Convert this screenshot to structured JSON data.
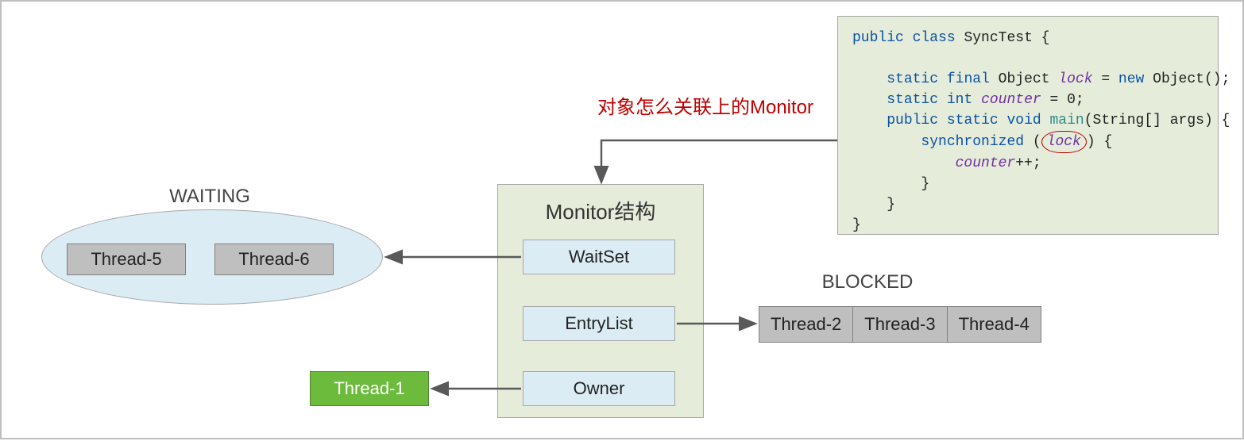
{
  "labels": {
    "waiting": "WAITING",
    "blocked": "BLOCKED",
    "monitor_title": "Monitor结构",
    "annotation": "对象怎么关联上的Monitor"
  },
  "threads": {
    "waiting": [
      "Thread-5",
      "Thread-6"
    ],
    "blocked": [
      "Thread-2",
      "Thread-3",
      "Thread-4"
    ],
    "owner": "Thread-1"
  },
  "monitor_slots": [
    "WaitSet",
    "EntryList",
    "Owner"
  ],
  "code": {
    "kw_public": "public",
    "kw_class": "class",
    "class_name": "SyncTest",
    "kw_static": "static",
    "kw_final": "final",
    "obj_type": "Object",
    "lock_name": "lock",
    "kw_new": "new",
    "ctor": "Object()",
    "kw_int": "int",
    "counter_name": "counter",
    "counter_init": "0",
    "kw_void": "void",
    "main_name": "main",
    "main_params": "(String[] args)",
    "kw_sync": "synchronized",
    "inc": "++;"
  }
}
